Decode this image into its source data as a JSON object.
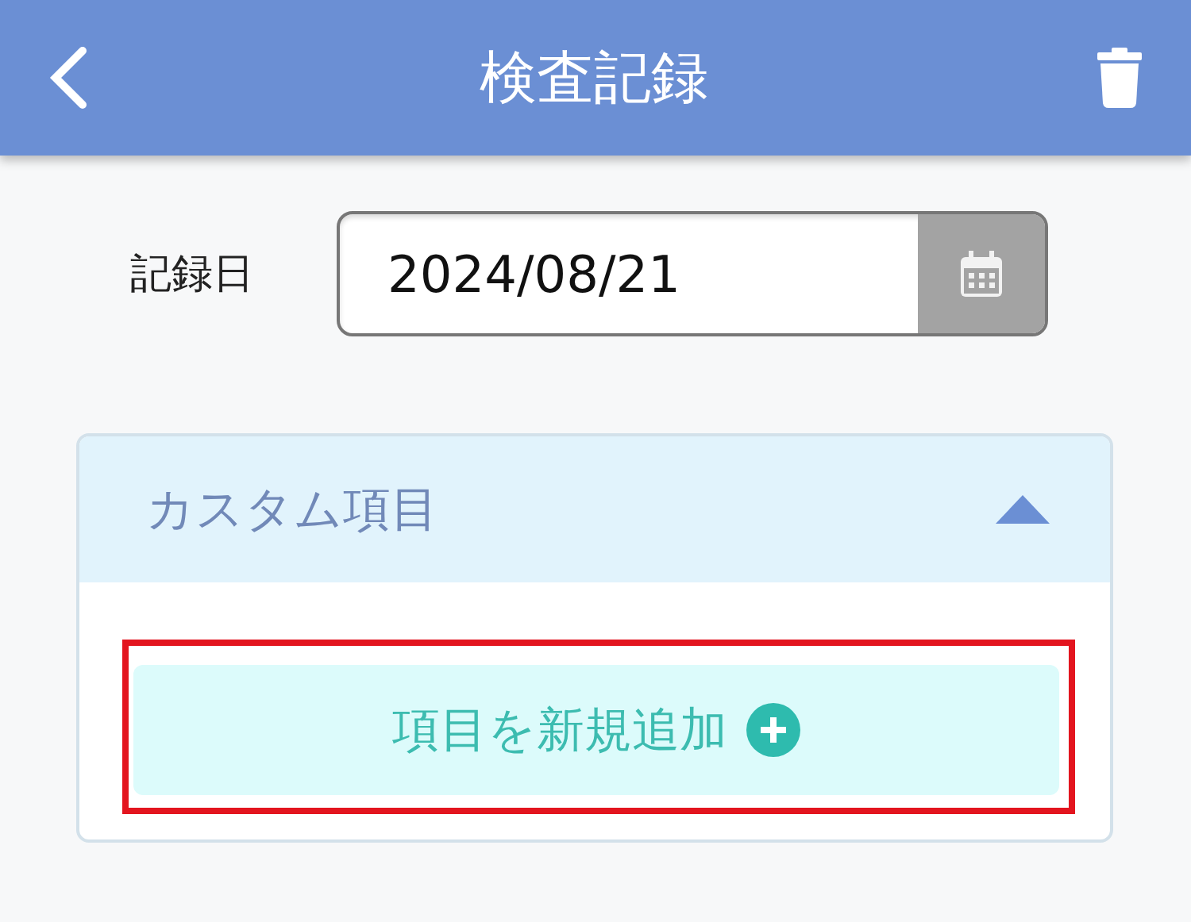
{
  "header": {
    "title": "検査記録"
  },
  "record_date": {
    "label": "記録日",
    "value": "2024/08/21"
  },
  "custom_section": {
    "title": "カスタム項目",
    "expanded": true,
    "add_button": {
      "label": "項目を新規追加",
      "highlighted": true
    }
  }
}
